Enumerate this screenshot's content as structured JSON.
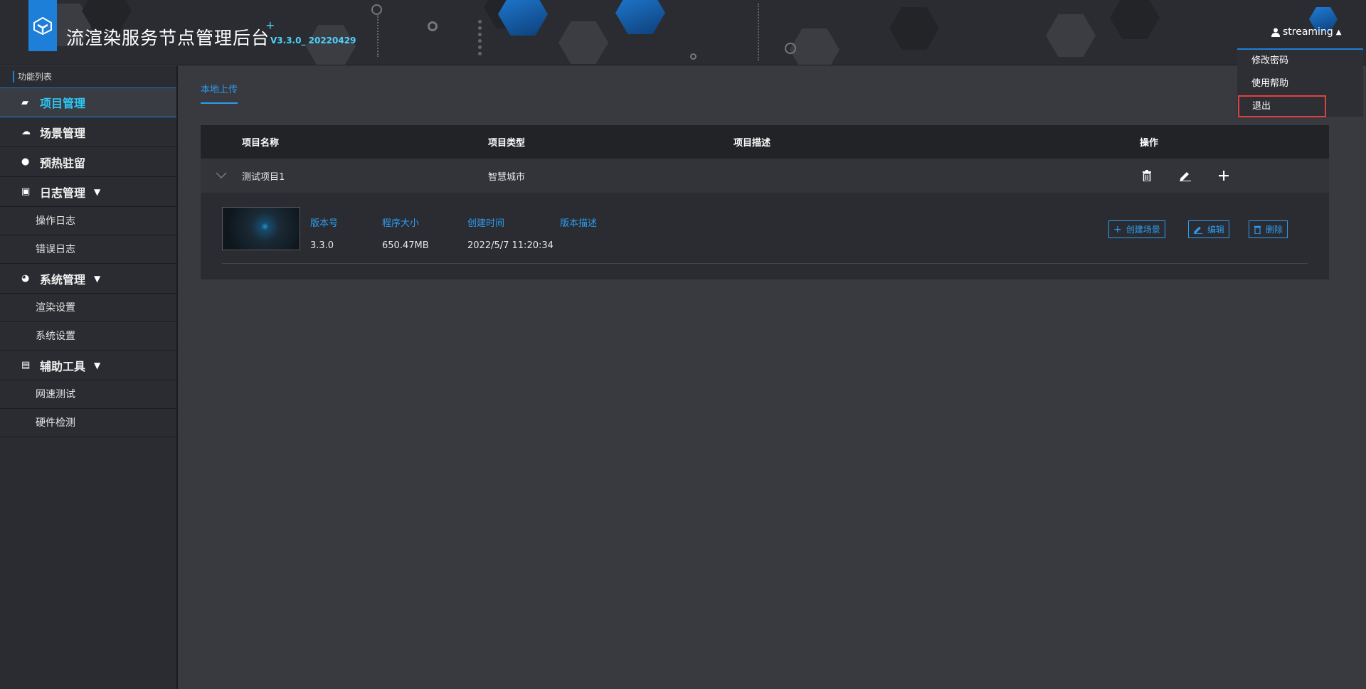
{
  "header": {
    "title": "流渲染服务节点管理后台",
    "plus": "+",
    "version": "V3.3.0_ 20220429",
    "user_icon": "user-icon",
    "username": "streaming",
    "caret": "▲",
    "menu": [
      {
        "label": "修改密码"
      },
      {
        "label": "使用帮助"
      },
      {
        "label": "退出"
      }
    ]
  },
  "sidebar": {
    "heading": "功能列表",
    "items": {
      "project": {
        "label": "项目管理",
        "icon": "folder-icon"
      },
      "scene": {
        "label": "场景管理",
        "icon": "cloud-icon"
      },
      "preheat": {
        "label": "预热驻留",
        "icon": "bolt-icon"
      },
      "log": {
        "label": "日志管理",
        "icon": "archive-icon"
      },
      "op_log": {
        "label": "操作日志"
      },
      "err_log": {
        "label": "错误日志"
      },
      "system": {
        "label": "系统管理",
        "icon": "dashboard-icon"
      },
      "render": {
        "label": "渲染设置"
      },
      "sys_set": {
        "label": "系统设置"
      },
      "tools": {
        "label": "辅助工具",
        "icon": "printer-icon"
      },
      "speed": {
        "label": "网速测试"
      },
      "hardware": {
        "label": "硬件检测"
      }
    }
  },
  "main": {
    "tab": "本地上传",
    "columns": [
      "项目名称",
      "项目类型",
      "项目描述",
      "操作"
    ],
    "row": {
      "name": "测试项目1",
      "type": "智慧城市",
      "desc": ""
    },
    "detail": {
      "labels": [
        "版本号",
        "程序大小",
        "创建时间",
        "版本描述"
      ],
      "values": [
        "3.3.0",
        "650.47MB",
        "2022/5/7 11:20:34",
        ""
      ],
      "buttons": [
        "创建场景",
        "编辑",
        "删除"
      ]
    }
  }
}
